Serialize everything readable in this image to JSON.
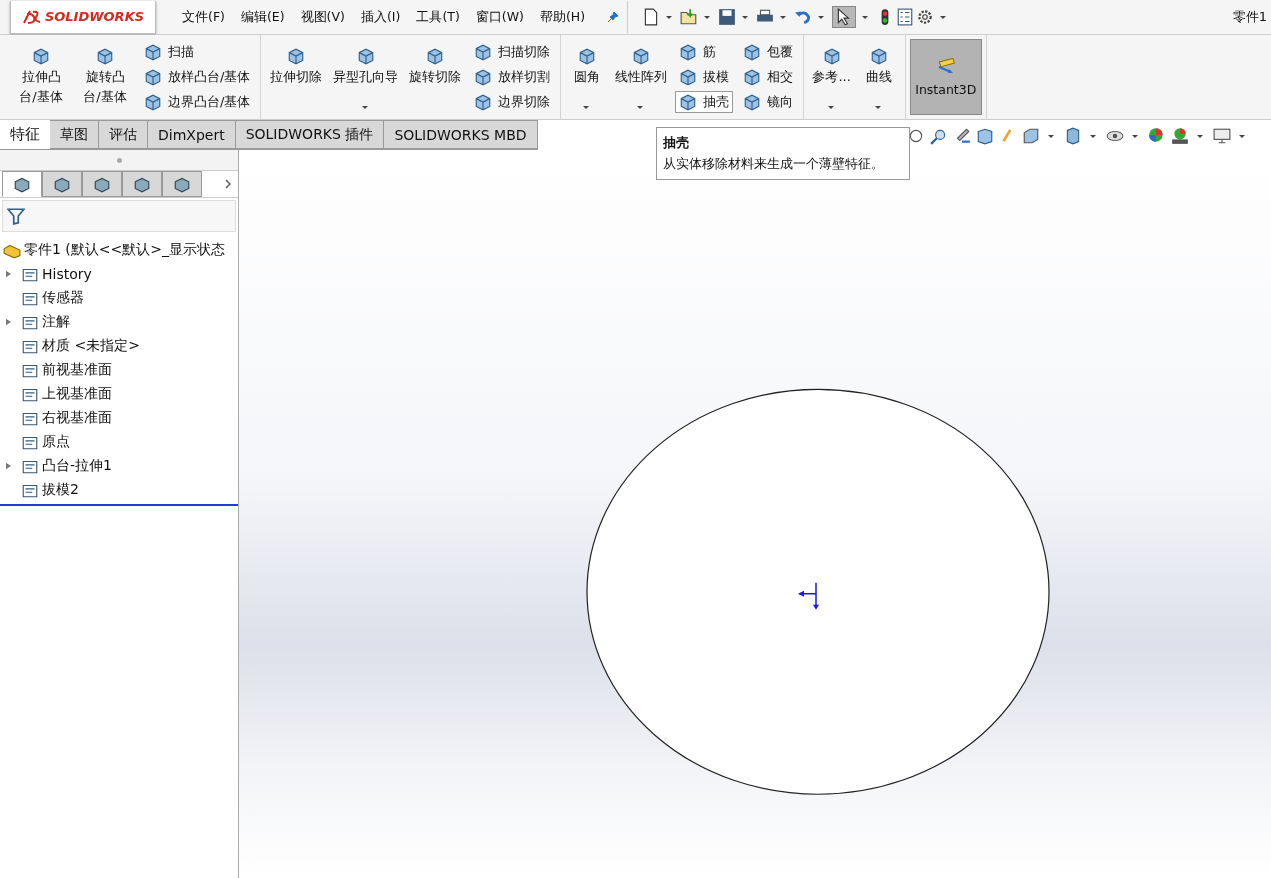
{
  "app": {
    "logo": "SOLIDWORKS",
    "title": "零件1"
  },
  "menu": [
    {
      "label": "文件(F)"
    },
    {
      "label": "编辑(E)"
    },
    {
      "label": "视图(V)"
    },
    {
      "label": "插入(I)"
    },
    {
      "label": "工具(T)"
    },
    {
      "label": "窗口(W)"
    },
    {
      "label": "帮助(H)"
    }
  ],
  "ribbon": {
    "groups": [
      {
        "items": [
          {
            "kind": "big",
            "label": "拉伸凸台/基体",
            "dropdown": false
          },
          {
            "kind": "big",
            "label": "旋转凸台/基体",
            "dropdown": false
          },
          {
            "kind": "stack",
            "items": [
              {
                "label": "扫描",
                "hovered": false
              },
              {
                "label": "放样凸台/基体",
                "hovered": false
              },
              {
                "label": "边界凸台/基体",
                "hovered": false
              }
            ]
          }
        ]
      },
      {
        "items": [
          {
            "kind": "big",
            "label": "拉伸切除",
            "dropdown": false
          },
          {
            "kind": "big",
            "label": "异型孔向导",
            "dropdown": true
          },
          {
            "kind": "big",
            "label": "旋转切除",
            "dropdown": false
          },
          {
            "kind": "stack",
            "items": [
              {
                "label": "扫描切除",
                "hovered": false
              },
              {
                "label": "放样切割",
                "hovered": false
              },
              {
                "label": "边界切除",
                "hovered": false
              }
            ]
          }
        ]
      },
      {
        "items": [
          {
            "kind": "big",
            "label": "圆角",
            "dropdown": true
          },
          {
            "kind": "big",
            "label": "线性阵列",
            "dropdown": true
          },
          {
            "kind": "stack",
            "items": [
              {
                "label": "筋",
                "hovered": false
              },
              {
                "label": "拔模",
                "hovered": false
              },
              {
                "label": "抽壳",
                "hovered": true
              }
            ]
          },
          {
            "kind": "stack",
            "items": [
              {
                "label": "包覆",
                "hovered": false
              },
              {
                "label": "相交",
                "hovered": false
              },
              {
                "label": "镜向",
                "hovered": false
              }
            ]
          }
        ]
      },
      {
        "items": [
          {
            "kind": "big",
            "label": "参考...",
            "dropdown": true
          },
          {
            "kind": "big",
            "label": "曲线",
            "dropdown": true
          }
        ]
      },
      {
        "items": [
          {
            "kind": "toggle",
            "label": "Instant3D",
            "on": true
          }
        ]
      }
    ]
  },
  "tabs": [
    {
      "label": "特征",
      "selected": true
    },
    {
      "label": "草图",
      "selected": false
    },
    {
      "label": "评估",
      "selected": false
    },
    {
      "label": "DimXpert",
      "selected": false
    },
    {
      "label": "SOLIDWORKS 插件",
      "selected": false
    },
    {
      "label": "SOLIDWORKS MBD",
      "selected": false
    }
  ],
  "panel_tabs": [
    {
      "selected": true
    },
    {
      "selected": false
    },
    {
      "selected": false
    },
    {
      "selected": false
    },
    {
      "selected": false
    }
  ],
  "tree": {
    "label": "零件1  (默认<<默认>_显示状态",
    "children": [
      {
        "label": "History",
        "expandable": true
      },
      {
        "label": "传感器",
        "expandable": false
      },
      {
        "label": "注解",
        "expandable": true
      },
      {
        "label": "材质 <未指定>",
        "expandable": false
      },
      {
        "label": "前视基准面",
        "expandable": false
      },
      {
        "label": "上视基准面",
        "expandable": false
      },
      {
        "label": "右视基准面",
        "expandable": false
      },
      {
        "label": "原点",
        "expandable": false
      },
      {
        "label": "凸台-拉伸1",
        "expandable": true
      },
      {
        "label": "拔模2",
        "expandable": false
      }
    ]
  },
  "tooltip": {
    "title": "抽壳",
    "text": "从实体移除材料来生成一个薄壁特征。"
  }
}
